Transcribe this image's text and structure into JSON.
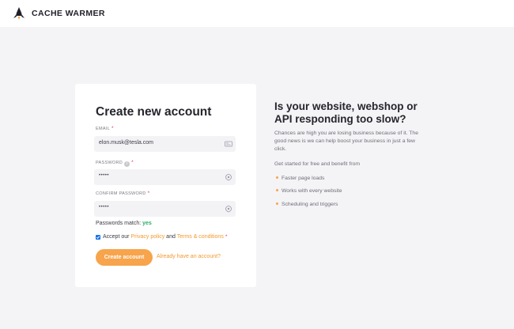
{
  "header": {
    "brand": "CACHE WARMER",
    "logo_icon": "rocket-logo-icon"
  },
  "form": {
    "title": "Create new account",
    "email": {
      "label": "EMAIL",
      "required": "*",
      "value": "elon.musk@tesla.com",
      "icon": "id-card-icon"
    },
    "password": {
      "label": "PASSWORD",
      "required": "*",
      "info": "i",
      "value": "•••••",
      "icon": "eye-icon"
    },
    "confirm": {
      "label": "CONFIRM PASSWORD",
      "required": "*",
      "value": "•••••",
      "icon": "eye-icon"
    },
    "match": {
      "label": "Passwords match:",
      "value": "yes"
    },
    "terms": {
      "checked": true,
      "prefix": "Accept our",
      "privacy": "Privacy policy",
      "and": "and",
      "terms": "Terms & conditions",
      "required": "*"
    },
    "submit_label": "Create account",
    "login_link": "Already have an account?"
  },
  "hero": {
    "title": "Is your website, webshop or API responding too slow?",
    "description": "Chances are high you are losing business because of it. The good news is we can help boost your business in just a few click.",
    "subheading": "Get started for free and benefit from",
    "features": [
      "Faster page loads",
      "Works with every website",
      "Scheduling and triggers"
    ]
  },
  "colors": {
    "accent": "#f7a44c",
    "link": "#f29a2e",
    "success": "#2eaa6a",
    "required": "#e8384f",
    "background": "#f4f4f6"
  }
}
